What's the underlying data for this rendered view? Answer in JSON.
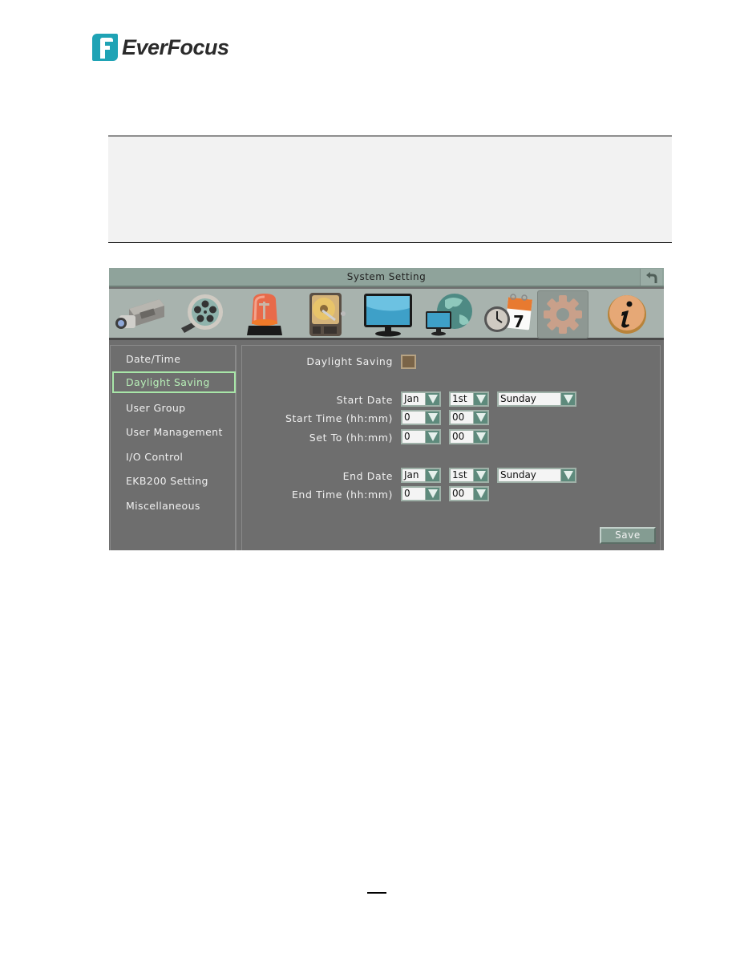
{
  "logo": {
    "brand": "EverFocus",
    "brand_color": "#1fa3b5"
  },
  "window": {
    "title": "System Setting",
    "back_icon": "undo-arrow-icon"
  },
  "toolbar": {
    "icons": [
      {
        "name": "camera-icon",
        "label": "Camera"
      },
      {
        "name": "film-reel-icon",
        "label": "Record"
      },
      {
        "name": "alarm-light-icon",
        "label": "Event"
      },
      {
        "name": "hard-disk-icon",
        "label": "Storage"
      },
      {
        "name": "monitor-icon",
        "label": "Display"
      },
      {
        "name": "network-globe-icon",
        "label": "Network"
      },
      {
        "name": "clock-calendar-icon",
        "label": "Schedule"
      },
      {
        "name": "gear-icon",
        "label": "System",
        "active": true
      },
      {
        "name": "info-icon",
        "label": "Information"
      }
    ],
    "calendar_day": "7"
  },
  "sidebar": {
    "items": [
      {
        "label": "Date/Time"
      },
      {
        "label": "Daylight Saving",
        "active": true
      },
      {
        "label": "User Group"
      },
      {
        "label": "User Management"
      },
      {
        "label": "I/O Control"
      },
      {
        "label": "EKB200 Setting"
      },
      {
        "label": "Miscellaneous"
      }
    ]
  },
  "form": {
    "daylight_saving": {
      "label": "Daylight Saving",
      "checked": false
    },
    "start_date": {
      "label": "Start Date",
      "month": "Jan",
      "week": "1st",
      "day": "Sunday"
    },
    "start_time": {
      "label": "Start Time (hh:mm)",
      "hour": "0",
      "minute": "00"
    },
    "set_to": {
      "label": "Set To (hh:mm)",
      "hour": "0",
      "minute": "00"
    },
    "end_date": {
      "label": "End Date",
      "month": "Jan",
      "week": "1st",
      "day": "Sunday"
    },
    "end_time": {
      "label": "End Time (hh:mm)",
      "hour": "0",
      "minute": "00"
    },
    "save_label": "Save"
  }
}
